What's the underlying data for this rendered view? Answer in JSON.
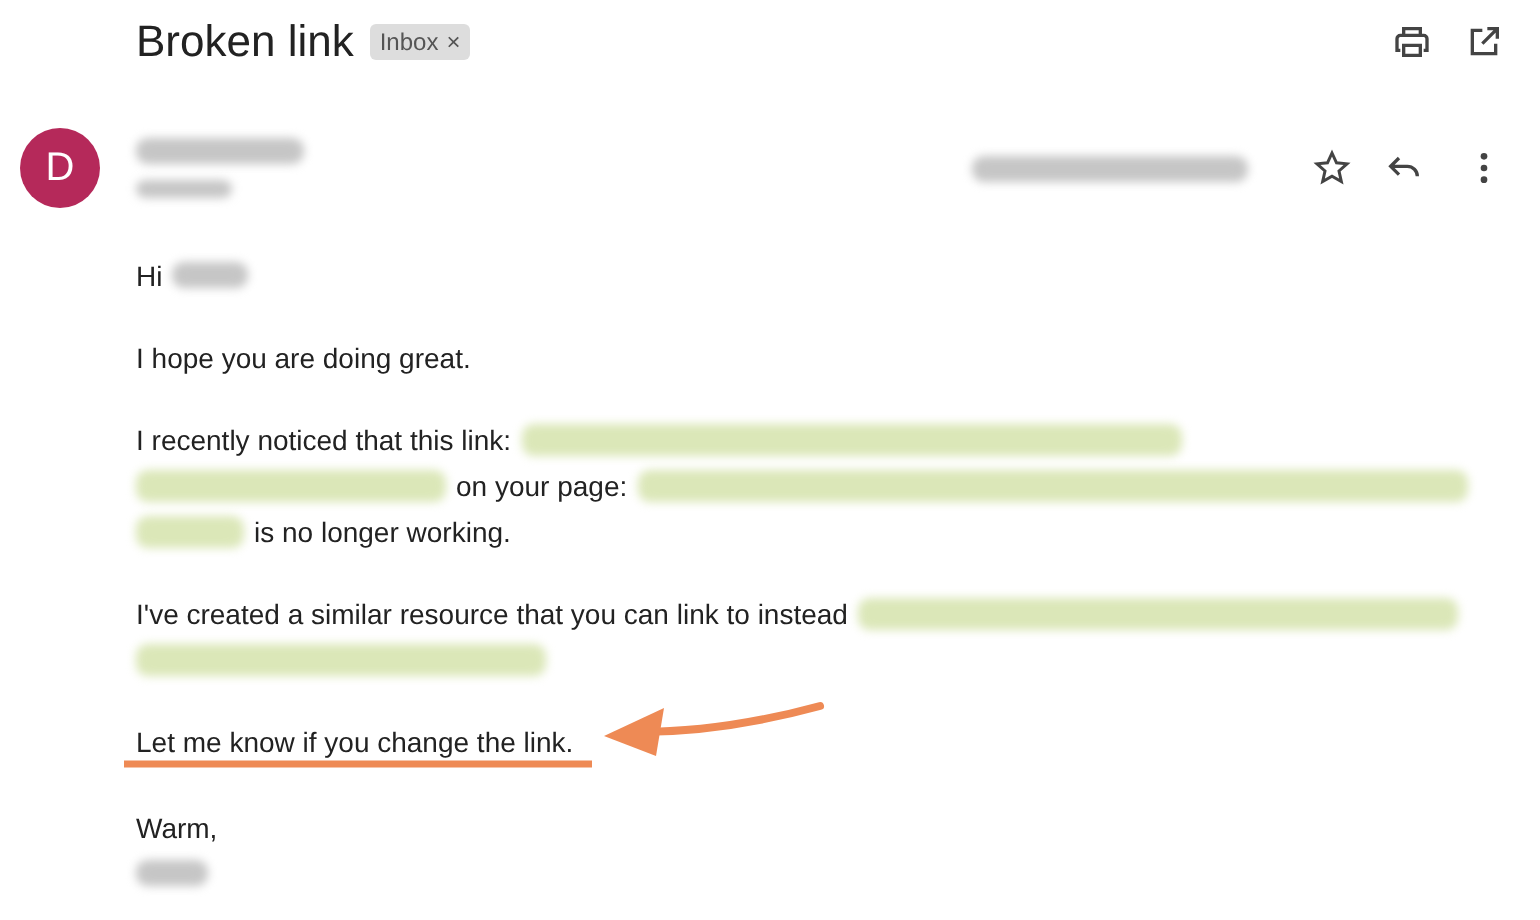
{
  "subject": "Broken link",
  "labels": [
    {
      "text": "Inbox",
      "close": "×"
    }
  ],
  "sender": {
    "initial": "D",
    "color": "#b5295a",
    "starred": false
  },
  "body": [
    {
      "lines": [
        [
          {
            "kind": "text",
            "text": "Hi"
          },
          {
            "kind": "blur-name"
          }
        ]
      ]
    },
    {
      "lines": [
        [
          {
            "kind": "text",
            "text": "I hope you are doing great."
          }
        ]
      ]
    },
    {
      "lines": [
        [
          {
            "kind": "text",
            "text": "I recently noticed that this link:"
          },
          {
            "kind": "blur-link"
          }
        ],
        [
          {
            "kind": "blur-link"
          },
          {
            "kind": "text",
            "text": "on your page:"
          },
          {
            "kind": "blur-link"
          }
        ],
        [
          {
            "kind": "blur-link"
          },
          {
            "kind": "text",
            "text": "is no longer working."
          }
        ]
      ]
    },
    {
      "lines": [
        [
          {
            "kind": "text",
            "text": "I've created a similar resource that you can link to instead"
          },
          {
            "kind": "blur-link"
          }
        ],
        [
          {
            "kind": "blur-link"
          }
        ]
      ]
    },
    {
      "lines": [
        [
          {
            "kind": "text",
            "text": "Let me know if you change the link.",
            "annotated": true
          }
        ]
      ]
    },
    {
      "lines": [
        [
          {
            "kind": "text",
            "text": "Warm,"
          }
        ],
        [
          {
            "kind": "blur-name"
          }
        ]
      ]
    }
  ]
}
